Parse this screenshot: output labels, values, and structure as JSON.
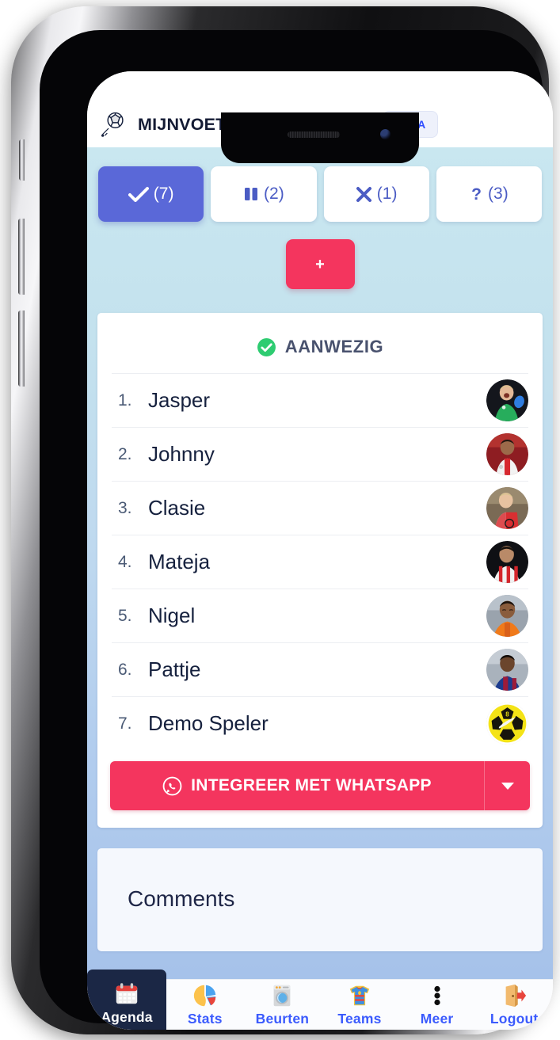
{
  "header": {
    "logo_icon": "soccer-ball-icon",
    "title": "MIJNVOETBALTEAM.COM",
    "beta_badge": "BETA"
  },
  "filters": [
    {
      "icon": "check-icon",
      "count": "(7)",
      "active": true
    },
    {
      "icon": "pause-icon",
      "count": "(2)",
      "active": false
    },
    {
      "icon": "cross-icon",
      "count": "(1)",
      "active": false
    },
    {
      "icon": "question-icon",
      "count": "(3)",
      "active": false
    }
  ],
  "add_button": {
    "label": "+",
    "icon": "plus-icon"
  },
  "attendance": {
    "status_icon": "check-circle-icon",
    "status_label": "AANWEZIG",
    "players": [
      {
        "index": "1.",
        "name": "Jasper",
        "avatar": "goalkeeper-green-photo"
      },
      {
        "index": "2.",
        "name": "Johnny",
        "avatar": "ajax-player-photo"
      },
      {
        "index": "3.",
        "name": "Clasie",
        "avatar": "feyenoord-player-photo"
      },
      {
        "index": "4.",
        "name": "Mateja",
        "avatar": "psv-player-photo"
      },
      {
        "index": "5.",
        "name": "Nigel",
        "avatar": "netherlands-player-photo"
      },
      {
        "index": "6.",
        "name": "Pattje",
        "avatar": "barcelona-player-photo"
      },
      {
        "index": "7.",
        "name": "Demo Speler",
        "avatar": "yellow-football-photo"
      }
    ]
  },
  "whatsapp": {
    "icon": "whatsapp-icon",
    "label": "INTEGREER MET WHATSAPP",
    "caret_icon": "chevron-down-icon"
  },
  "comments": {
    "title": "Comments"
  },
  "bottom_nav": [
    {
      "label": "Agenda",
      "icon": "calendar-icon",
      "active": true
    },
    {
      "label": "Stats",
      "icon": "pie-chart-icon",
      "active": false
    },
    {
      "label": "Beurten",
      "icon": "washing-machine-icon",
      "active": false
    },
    {
      "label": "Teams",
      "icon": "jersey-icon",
      "active": false
    },
    {
      "label": "Meer",
      "icon": "dots-vertical-icon",
      "active": false
    },
    {
      "label": "Logout",
      "icon": "exit-door-icon",
      "active": false
    }
  ],
  "colors": {
    "accent_purple": "#5a68d8",
    "accent_red": "#f4355e",
    "nav_blue": "#3b5bfd",
    "nav_active_bg": "#1b2745",
    "status_green": "#2ecc71"
  }
}
